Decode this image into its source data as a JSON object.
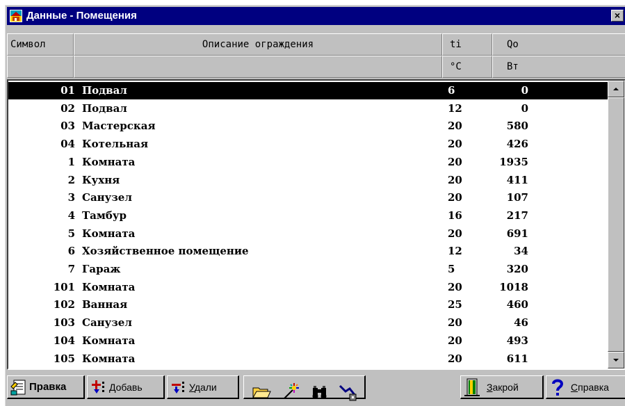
{
  "window": {
    "title": "Данные - Помещения",
    "close_glyph": "×"
  },
  "header": {
    "columns": [
      {
        "key": "symbol",
        "label": "Символ",
        "unit": ""
      },
      {
        "key": "description",
        "label": "Описание ограждения",
        "unit": ""
      },
      {
        "key": "ti",
        "label": "ti",
        "unit": "°C"
      },
      {
        "key": "qo",
        "label": "Qo",
        "unit": "Вт"
      }
    ]
  },
  "rows": [
    {
      "symbol": "01",
      "description": "Подвал",
      "ti": "6",
      "qo": "0",
      "selected": true
    },
    {
      "symbol": "02",
      "description": "Подвал",
      "ti": "12",
      "qo": "0"
    },
    {
      "symbol": "03",
      "description": "Мастерская",
      "ti": "20",
      "qo": "580"
    },
    {
      "symbol": "04",
      "description": "Котельная",
      "ti": "20",
      "qo": "426"
    },
    {
      "symbol": "1",
      "description": "Комната",
      "ti": "20",
      "qo": "1935"
    },
    {
      "symbol": "2",
      "description": "Кухня",
      "ti": "20",
      "qo": "411"
    },
    {
      "symbol": "3",
      "description": "Санузел",
      "ti": "20",
      "qo": "107"
    },
    {
      "symbol": "4",
      "description": "Тамбур",
      "ti": "16",
      "qo": "217"
    },
    {
      "symbol": "5",
      "description": "Комната",
      "ti": "20",
      "qo": "691"
    },
    {
      "symbol": "6",
      "description": "Хозяйственное помещение",
      "ti": "12",
      "qo": "34"
    },
    {
      "symbol": "7",
      "description": "Гараж",
      "ti": "5",
      "qo": "320"
    },
    {
      "symbol": "101",
      "description": "Комната",
      "ti": "20",
      "qo": "1018"
    },
    {
      "symbol": "102",
      "description": "Ванная",
      "ti": "25",
      "qo": "460"
    },
    {
      "symbol": "103",
      "description": "Санузел",
      "ti": "20",
      "qo": "46"
    },
    {
      "symbol": "104",
      "description": "Комната",
      "ti": "20",
      "qo": "493"
    },
    {
      "symbol": "105",
      "description": "Комната",
      "ti": "20",
      "qo": "611"
    }
  ],
  "toolbar": {
    "edit_label": "Правка",
    "add_label": "Добавь",
    "delete_label": "Удали",
    "close_label": "Закрой",
    "help_label": "Справка",
    "icons": [
      "edit-icon",
      "add-icon",
      "delete-icon",
      "folder-open-icon",
      "sparkle-icon",
      "binoculars-icon",
      "sort-icon",
      "exit-icon",
      "help-icon"
    ]
  },
  "colors": {
    "titlebar": "#000080",
    "face": "#c0c0c0",
    "selection": "#000000"
  }
}
